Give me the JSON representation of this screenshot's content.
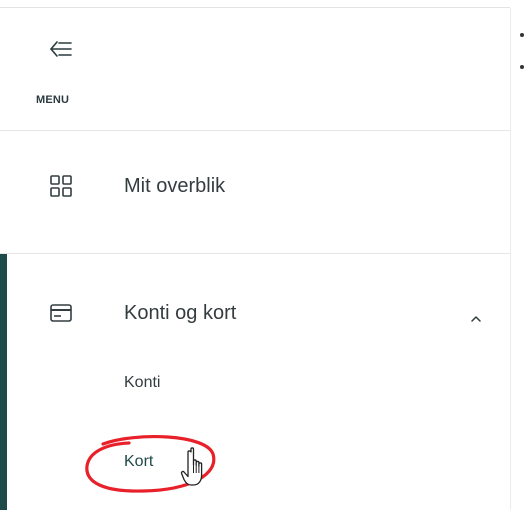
{
  "menu": {
    "toggle_label": "MENU",
    "toggle_icon": "arrow-left-lines-icon"
  },
  "nav": {
    "items": [
      {
        "label": "Mit overblik",
        "icon": "dashboard-grid-icon"
      },
      {
        "label": "Konti og kort",
        "icon": "credit-card-icon",
        "expanded": true,
        "children": [
          {
            "label": "Konti"
          },
          {
            "label": "Kort",
            "selected": true
          }
        ]
      }
    ]
  },
  "colors": {
    "accent": "#1e4a47",
    "text": "#333d40",
    "divider": "#e6e6e6",
    "annotation": "#e8202a"
  }
}
